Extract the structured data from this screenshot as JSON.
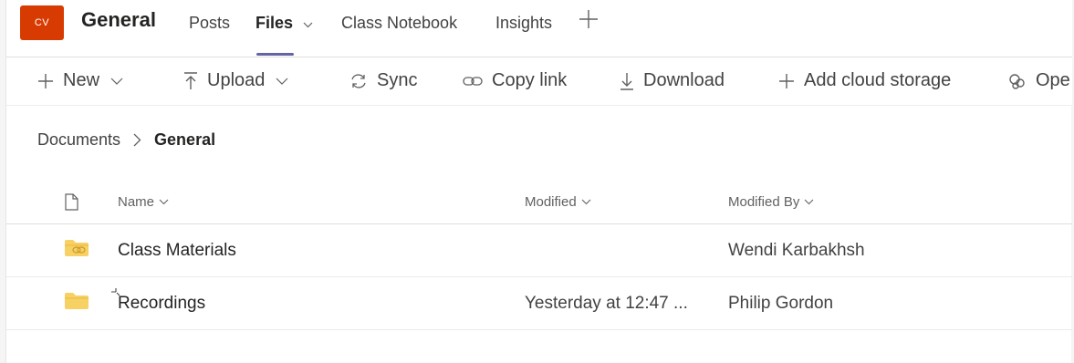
{
  "header": {
    "team_initials": "CV",
    "channel_name": "General",
    "tabs": [
      {
        "label": "Posts",
        "active": false
      },
      {
        "label": "Files",
        "active": true
      },
      {
        "label": "Class Notebook",
        "active": false
      },
      {
        "label": "Insights",
        "active": false
      }
    ],
    "add_tab_icon": "plus-icon",
    "accent_color": "#6264a7",
    "team_color": "#d83b01"
  },
  "toolbar": {
    "new_label": "New",
    "upload_label": "Upload",
    "sync_label": "Sync",
    "copy_link_label": "Copy link",
    "download_label": "Download",
    "add_cloud_storage_label": "Add cloud storage",
    "open_label": "Ope"
  },
  "breadcrumb": {
    "root": "Documents",
    "current": "General"
  },
  "table": {
    "columns": {
      "name": "Name",
      "modified": "Modified",
      "modified_by": "Modified By"
    },
    "rows": [
      {
        "name": "Class Materials",
        "modified": "",
        "modified_by": "Wendi Karbakhsh",
        "icon": "shared-folder-icon"
      },
      {
        "name": "Recordings",
        "modified": "Yesterday at 12:47 ...",
        "modified_by": "Philip Gordon",
        "icon": "folder-icon"
      }
    ],
    "folder_color": "#f8d164"
  }
}
